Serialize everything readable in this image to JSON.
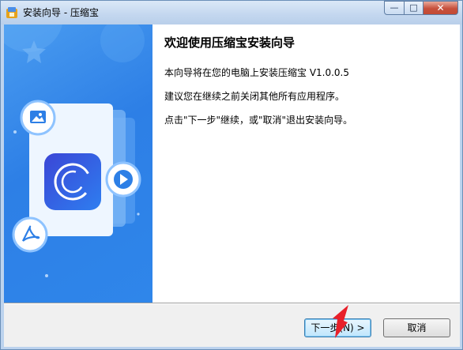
{
  "window": {
    "title": "安装向导 - 压缩宝",
    "controls": {
      "minimize": "—",
      "maximize": "□",
      "close": "✕"
    }
  },
  "wizard": {
    "heading": "欢迎使用压缩宝安装向导",
    "paragraphs": [
      "本向导将在您的电脑上安装压缩宝 V1.0.0.5",
      "建议您在继续之前关闭其他所有应用程序。",
      "点击\"下一步\"继续，或\"取消\"退出安装向导。"
    ]
  },
  "buttons": {
    "next": "下一步(N) >",
    "cancel": "取消"
  },
  "colors": {
    "panel": "#2d7fe6",
    "app_icon": "#3a57d8",
    "arrow": "#e8202a"
  },
  "icons": [
    "star-icon",
    "image-icon",
    "play-icon",
    "pdf-icon",
    "app-logo-icon"
  ]
}
